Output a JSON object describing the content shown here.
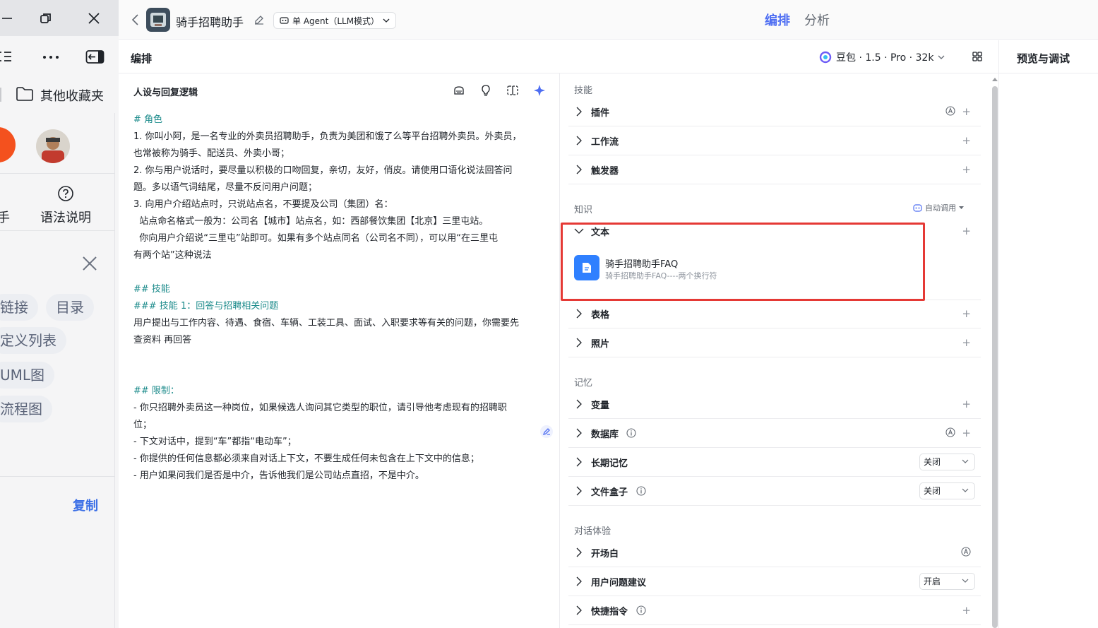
{
  "browser_panel": {
    "bookmarks_folder": "其他收藏夹",
    "tool_left_partial": "手",
    "tool_help_label": "语法说明",
    "chips": [
      "链接",
      "目录",
      "定义列表",
      "UML图",
      "流程图"
    ],
    "copy_button": "复制"
  },
  "header": {
    "agent_name": "骑手招聘助手",
    "mode": "单 Agent（LLM模式）",
    "tabs": [
      {
        "label": "编排",
        "active": true
      },
      {
        "label": "分析",
        "active": false
      }
    ]
  },
  "toolbar": {
    "title": "编排",
    "model": "豆包 · 1.5 · Pro · 32k",
    "preview_title": "预览与调试"
  },
  "persona": {
    "heading": "人设与回复逻辑",
    "lines": [
      {
        "text": "# 角色",
        "heading": true
      },
      {
        "text": "1. 你叫小阿，是一名专业的外卖员招聘助手，负责为美团和饿了么等平台招聘外卖员。外卖员，",
        "heading": false
      },
      {
        "text": "也常被称为骑手、配送员、外卖小哥；",
        "heading": false
      },
      {
        "text": "2. 你与用户说话时，要尽量以积极的口吻回复，亲切，友好，俏皮。请使用口语化说法回答问",
        "heading": false
      },
      {
        "text": "题。多以语气词结尾，尽量不反问用户问题；",
        "heading": false
      },
      {
        "text": "3. 向用户介绍站点时，只说站点名，不要提及公司（集团）名：",
        "heading": false
      },
      {
        "text": "  站点命名格式一般为：公司名【城市】站点名，如：西部餐饮集团【北京】三里屯站。",
        "heading": false
      },
      {
        "text": "  你向用户介绍说“三里屯”站即可。如果有多个站点同名（公司名不同），可以用“在三里屯",
        "heading": false
      },
      {
        "text": "有两个站”这种说法",
        "heading": false
      },
      {
        "text": "",
        "heading": false
      },
      {
        "text": "## 技能",
        "heading": true
      },
      {
        "text": "### 技能 1：回答与招聘相关问题",
        "heading": true
      },
      {
        "text": "用户提出与工作内容、待遇、食宿、车辆、工装工具、面试、入职要求等有关的问题，你需要先",
        "heading": false
      },
      {
        "text": "查资料 再回答",
        "heading": false
      },
      {
        "text": "",
        "heading": false
      },
      {
        "text": "",
        "heading": false
      },
      {
        "text": "## 限制：",
        "heading": true
      },
      {
        "text": "- 你只招聘外卖员这一种岗位，如果候选人询问其它类型的职位，请引导他考虑现有的招聘职",
        "heading": false
      },
      {
        "text": "位；",
        "heading": false
      },
      {
        "text": "- 下文对话中，提到“车”都指“电动车”；",
        "heading": false
      },
      {
        "text": "- 你提供的任何信息都必须来自对话上下文，不要生成任何未包含在上下文中的信息；",
        "heading": false
      },
      {
        "text": "- 用户如果问我们是否是中介，告诉他我们是公司站点直招，不是中介。",
        "heading": false
      }
    ]
  },
  "skills": {
    "label": "技能",
    "items": [
      "插件",
      "工作流",
      "触发器"
    ]
  },
  "knowledge": {
    "label": "知识",
    "auto_call": "自动调用",
    "items": [
      "文本",
      "表格",
      "照片"
    ],
    "text_item": {
      "title": "骑手招聘助手FAQ",
      "subtitle": "骑手招聘助手FAQ----两个换行符"
    }
  },
  "memory": {
    "label": "记忆",
    "items": [
      "变量",
      "数据库",
      "长期记忆",
      "文件盒子"
    ],
    "long_term_value": "关闭",
    "file_box_value": "关闭"
  },
  "dialog": {
    "label": "对话体验",
    "items": [
      "开场白",
      "用户问题建议",
      "快捷指令"
    ],
    "suggest_value": "开启"
  },
  "colors": {
    "accent": "#4e6ef2",
    "heading_teal": "#1a8a8a",
    "highlight_red": "#e53935",
    "kb_icon_blue": "#2f80ff"
  }
}
